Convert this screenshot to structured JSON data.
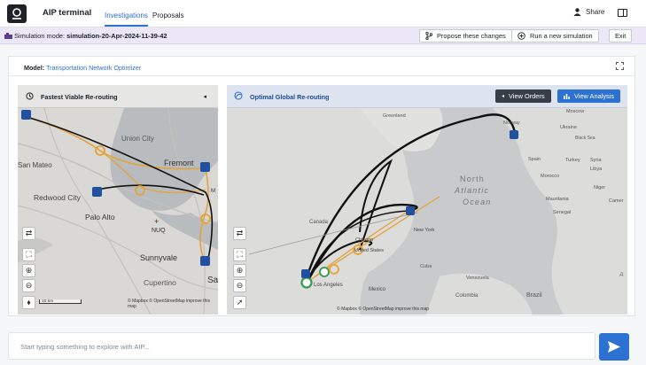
{
  "header": {
    "app_title": "AIP terminal",
    "tabs": [
      {
        "label": "Investigations",
        "active": true
      },
      {
        "label": "Proposals",
        "active": false
      }
    ],
    "share_label": "Share"
  },
  "simulation_bar": {
    "prefix": "Simulation mode:",
    "name": "simulation-20-Apr-2024-11-39-42",
    "propose_label": "Propose these changes",
    "run_label": "Run a new simulation",
    "exit_label": "Exit"
  },
  "model": {
    "label": "Model:",
    "name": "Transportation Network Optimizer"
  },
  "left_map": {
    "title": "Fastest Viable Re-routing",
    "places": [
      "Union City",
      "San Mateo",
      "Fremont",
      "Redwood City",
      "Palo Alto",
      "NUQ",
      "Sunnyvale",
      "Cupertino",
      "Sa",
      "M"
    ],
    "scale": "10 km",
    "attribution": "© Mapbox © OpenStreetMap improve this map"
  },
  "right_map": {
    "title": "Optimal Global Re-routing",
    "view_orders_label": "View Orders",
    "view_analysis_label": "View Analysis",
    "places": [
      "Greenland",
      "Norway",
      "Moscow",
      "Ukraine",
      "Black Sea",
      "Spain",
      "Turkey",
      "Syria",
      "Morocco",
      "Libya",
      "Mauritania",
      "Niger",
      "Senegal",
      "Camer",
      "Canada",
      "New York",
      "Chicago",
      "United States",
      "Los Angeles",
      "Mexico",
      "Cuba",
      "Venezuela",
      "Colombia",
      "Brazil",
      "A"
    ],
    "ocean_label": [
      "North",
      "Atlantic",
      "Ocean"
    ],
    "attribution": "© Mapbox © OpenStreetMap improve this map"
  },
  "input": {
    "placeholder": "Start typing something to explore with AIP..."
  },
  "colors": {
    "accent": "#2d72d2",
    "dark_button": "#383e47",
    "route_orange": "#e3a23a",
    "route_black": "#111111",
    "sim_banner": "#ece7f6"
  }
}
